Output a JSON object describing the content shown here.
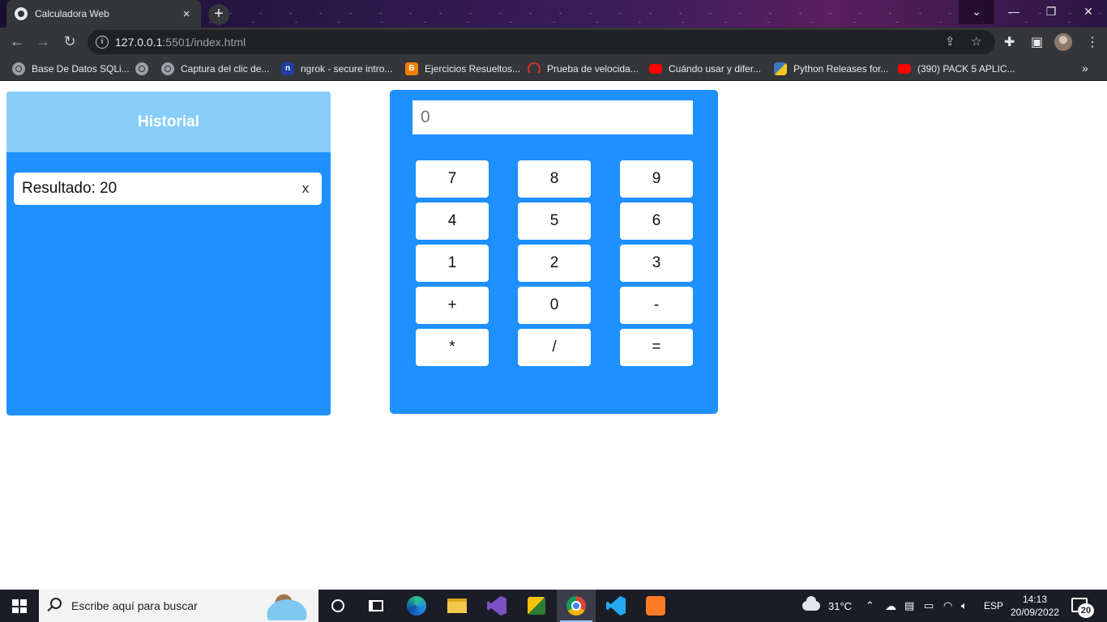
{
  "browser": {
    "tab_title": "Calculadora Web",
    "tab_close": "×",
    "new_tab": "+",
    "url_host": "127.0.0.1",
    "url_rest": ":5501/index.html",
    "window_controls": {
      "dropdown": "⌄",
      "minimize": "—",
      "restore": "❐",
      "close": "✕"
    },
    "bookmarks": [
      {
        "label": "Base De Datos SQLi...",
        "icon": "globe-icon"
      },
      {
        "label": "Captura del clic de...",
        "icon": "globe-icon"
      },
      {
        "label": "ngrok - secure intro...",
        "icon": "ngrok-icon",
        "glyph": "n"
      },
      {
        "label": "Ejercicios Resueltos...",
        "icon": "blogger-icon",
        "glyph": "B"
      },
      {
        "label": "Prueba de velocida...",
        "icon": "speedtest-icon"
      },
      {
        "label": "Cuándo usar y difer...",
        "icon": "youtube-icon"
      },
      {
        "label": "Python Releases for...",
        "icon": "python-icon"
      },
      {
        "label": "(390) PACK 5 APLIC...",
        "icon": "youtube-icon"
      }
    ],
    "bookmarks_more": "»"
  },
  "historial": {
    "title": "Historial",
    "items": [
      {
        "text": "Resultado: 20",
        "delete": "x"
      }
    ]
  },
  "calculator": {
    "display_placeholder": "0",
    "keys": [
      "7",
      "8",
      "9",
      "4",
      "5",
      "6",
      "1",
      "2",
      "3",
      "+",
      "0",
      "-",
      "*",
      "/",
      "="
    ]
  },
  "taskbar": {
    "search_placeholder": "Escribe aquí para buscar",
    "weather": "31°C",
    "language": "ESP",
    "time": "14:13",
    "date": "20/09/2022",
    "notifications": "20"
  }
}
